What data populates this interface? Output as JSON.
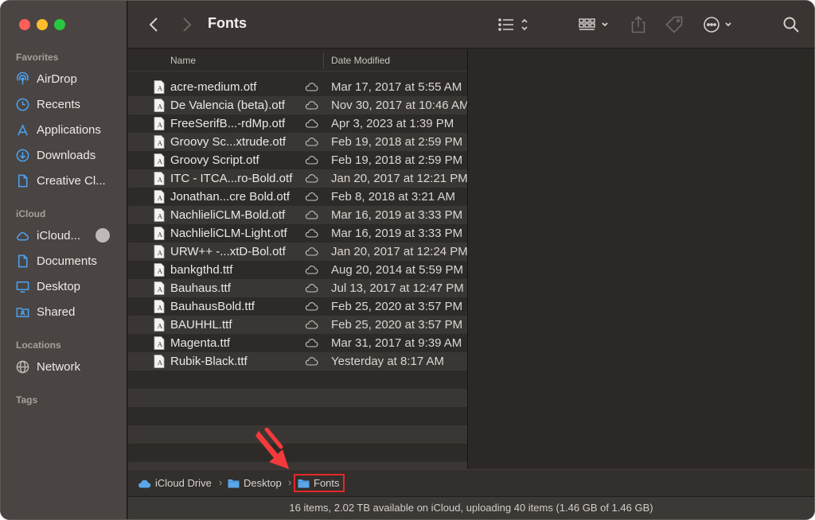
{
  "window": {
    "title": "Fonts"
  },
  "sidebar": {
    "sections": [
      {
        "header": "Favorites",
        "items": [
          {
            "label": "AirDrop",
            "icon": "airdrop-icon"
          },
          {
            "label": "Recents",
            "icon": "clock-icon"
          },
          {
            "label": "Applications",
            "icon": "applications-icon"
          },
          {
            "label": "Downloads",
            "icon": "download-icon"
          },
          {
            "label": "Creative Cl...",
            "icon": "document-icon"
          }
        ]
      },
      {
        "header": "iCloud",
        "items": [
          {
            "label": "iCloud...",
            "icon": "cloud-icon"
          },
          {
            "label": "Documents",
            "icon": "document-icon"
          },
          {
            "label": "Desktop",
            "icon": "desktop-icon"
          },
          {
            "label": "Shared",
            "icon": "shared-folder-icon"
          }
        ]
      },
      {
        "header": "Locations",
        "items": [
          {
            "label": "Network",
            "icon": "globe-icon"
          }
        ]
      },
      {
        "header": "Tags",
        "items": []
      }
    ]
  },
  "columns": {
    "name": "Name",
    "date": "Date Modified"
  },
  "files": [
    {
      "name": "acre-medium.otf",
      "date": "Mar 17, 2017 at 5:55 AM"
    },
    {
      "name": "De Valencia (beta).otf",
      "date": "Nov 30, 2017 at 10:46 AM"
    },
    {
      "name": "FreeSerifB...-rdMp.otf",
      "date": "Apr 3, 2023 at 1:39 PM"
    },
    {
      "name": "Groovy Sc...xtrude.otf",
      "date": "Feb 19, 2018 at 2:59 PM"
    },
    {
      "name": "Groovy Script.otf",
      "date": "Feb 19, 2018 at 2:59 PM"
    },
    {
      "name": "ITC - ITCA...ro-Bold.otf",
      "date": "Jan 20, 2017 at 12:21 PM"
    },
    {
      "name": "Jonathan...cre Bold.otf",
      "date": "Feb 8, 2018 at 3:21 AM"
    },
    {
      "name": "NachlieliCLM-Bold.otf",
      "date": "Mar 16, 2019 at 3:33 PM"
    },
    {
      "name": "NachlieliCLM-Light.otf",
      "date": "Mar 16, 2019 at 3:33 PM"
    },
    {
      "name": "URW++ -...xtD-Bol.otf",
      "date": "Jan 20, 2017 at 12:24 PM"
    },
    {
      "name": "bankgthd.ttf",
      "date": "Aug 20, 2014 at 5:59 PM"
    },
    {
      "name": "Bauhaus.ttf",
      "date": "Jul 13, 2017 at 12:47 PM"
    },
    {
      "name": "BauhausBold.ttf",
      "date": "Feb 25, 2020 at 3:57 PM"
    },
    {
      "name": "BAUHHL.ttf",
      "date": "Feb 25, 2020 at 3:57 PM"
    },
    {
      "name": "Magenta.ttf",
      "date": "Mar 31, 2017 at 9:39 AM"
    },
    {
      "name": "Rubik-Black.ttf",
      "date": "Yesterday at 8:17 AM"
    }
  ],
  "pathbar": {
    "crumbs": [
      "iCloud Drive",
      "Desktop",
      "Fonts"
    ]
  },
  "status": {
    "text": "16 items, 2.02 TB available on iCloud, uploading 40 items (1.46 GB of 1.46 GB)"
  },
  "colors": {
    "accent": "#4aa3f5",
    "highlight_box": "#e3292b",
    "arrow": "#f23a3c",
    "close": "#fe5f57",
    "minimize": "#febc2e",
    "zoom": "#28c840"
  }
}
